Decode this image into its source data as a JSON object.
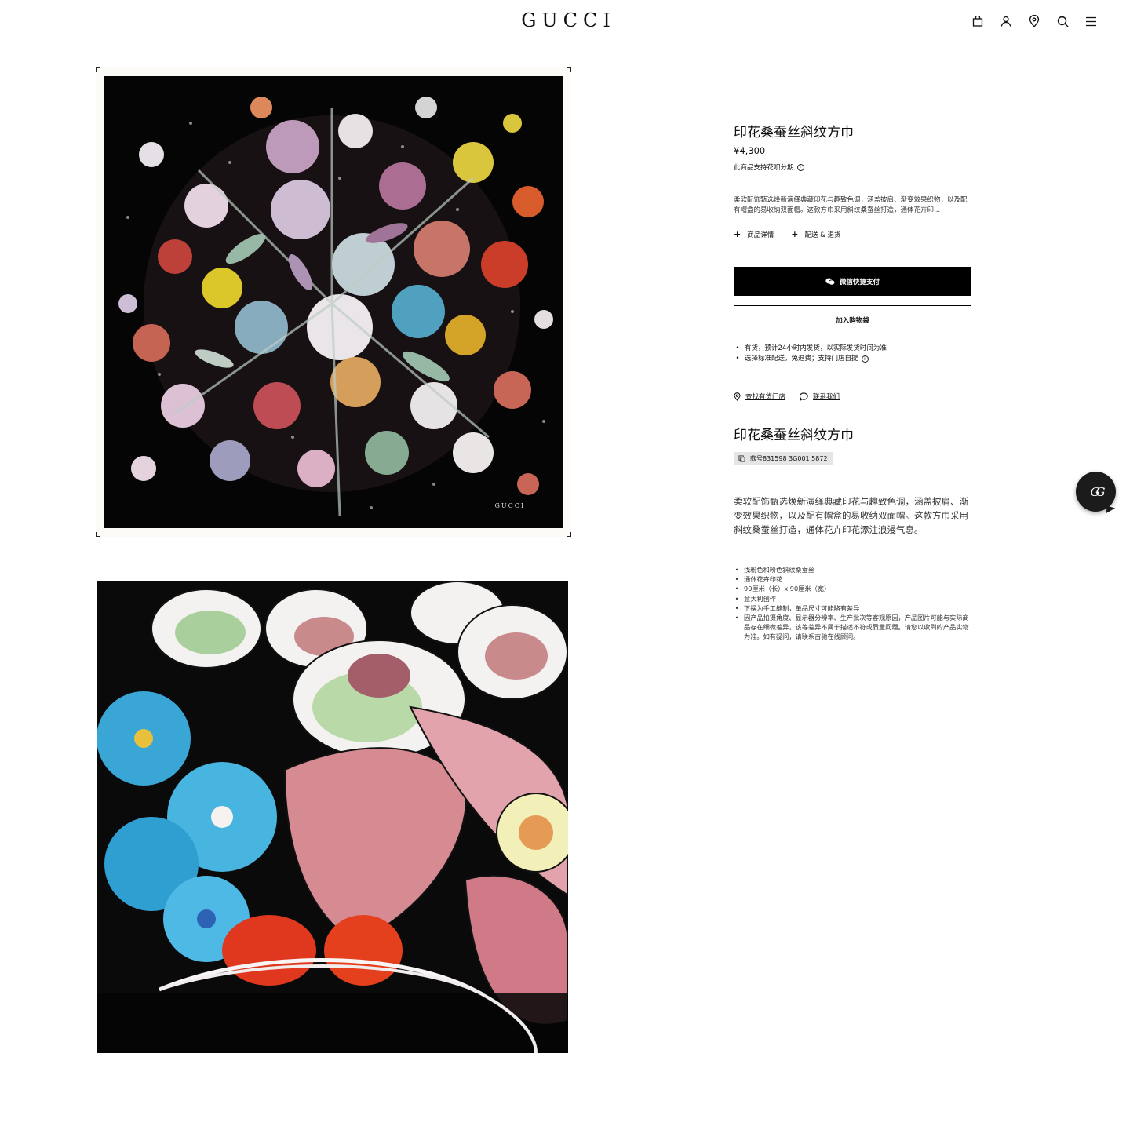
{
  "header": {
    "logo": "GUCCI",
    "icons": [
      "bag-icon",
      "account-icon",
      "store-locator-icon",
      "search-icon",
      "menu-icon"
    ]
  },
  "images": {
    "main_alt": "印花桑蚕丝斜纹方巾",
    "scarf_mark": "GUCCI",
    "detail_alt": "印花桑蚕丝斜纹方巾 细节"
  },
  "product": {
    "title": "印花桑蚕丝斜纹方巾",
    "price": "¥4,300",
    "installment": "此商品支持花呗分期",
    "short_description": "柔软配饰甄选焕新演绎典藏印花与趣致色调，涵盖披肩、渐变效果织物，以及配有帽盒的易收纳双面帽。这款方巾采用斜纹桑蚕丝打造，通体花卉印...",
    "expanders": [
      "商品详情",
      "配送 & 退货"
    ],
    "wechat_pay_label": "微信快捷支付",
    "add_to_bag_label": "加入购物袋",
    "shipping": [
      "有货，预计24小时内发货，以实际发货时间为准",
      "选择标准配送，免退费；支持门店自提"
    ],
    "links": {
      "find_store": "查找有货门店",
      "contact": "联系我们"
    },
    "title_repeat": "印花桑蚕丝斜纹方巾",
    "style_number": "款号831598 3G001 5872",
    "long_description": "柔软配饰甄选焕新演绎典藏印花与趣致色调，涵盖披肩、渐变效果织物，以及配有帽盒的易收纳双面帽。这款方巾采用斜纹桑蚕丝打造，通体花卉印花添注浪漫气息。",
    "details": [
      "浅粉色和粉色斜纹桑蚕丝",
      "通体花卉印花",
      "90厘米（长）x 90厘米（宽）",
      "意大利创作",
      "下摆为手工缝制，单品尺寸可能略有差异",
      "因产品拍摄角度、显示器分辨率、生产批次等客观原因，产品图片可能与实际商品存在细微差异，该等差异不属于描述不符或质量问题。请您以收到的产品实物为准。如有疑问，请联系古驰在线顾问。"
    ]
  },
  "chat_fab": {
    "label": "GG"
  },
  "colors": {
    "black": "#000000",
    "badge_bg": "#e5e5e5"
  }
}
